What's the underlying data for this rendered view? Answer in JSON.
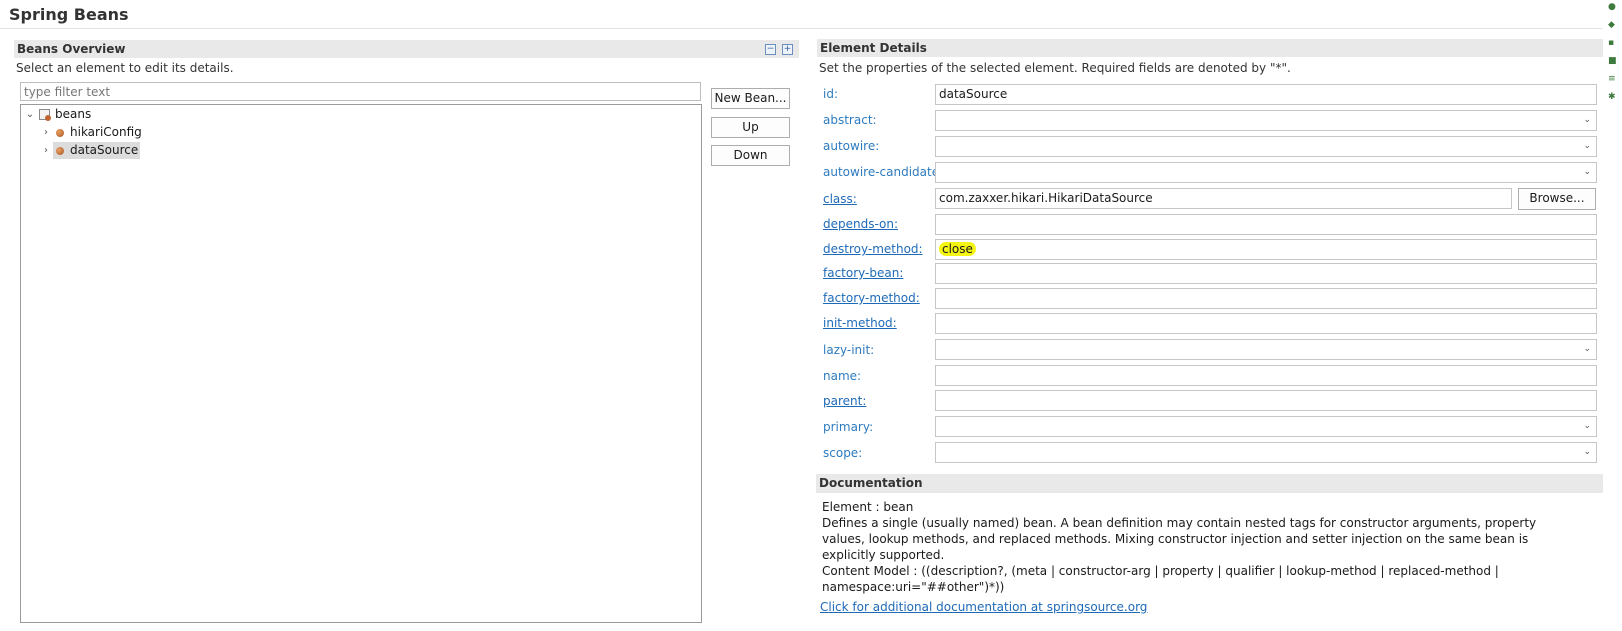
{
  "page_title": "Spring Beans",
  "beans_overview": {
    "title": "Beans Overview",
    "description": "Select an element to edit its details.",
    "filter_placeholder": "type filter text",
    "tree": {
      "root": "beans",
      "children": [
        "hikariConfig",
        "dataSource"
      ],
      "selected": "dataSource"
    },
    "buttons": {
      "new_bean": "New Bean...",
      "up": "Up",
      "down": "Down"
    }
  },
  "element_details": {
    "title": "Element Details",
    "description": "Set the properties of the selected element. Required fields are denoted by \"*\".",
    "fields": {
      "id": {
        "label": "id:",
        "value": "dataSource"
      },
      "abstract": {
        "label": "abstract:",
        "value": ""
      },
      "autowire": {
        "label": "autowire:",
        "value": ""
      },
      "autowire_candidate": {
        "label": "autowire-candidate:",
        "value": ""
      },
      "class": {
        "label": "class:",
        "value": "com.zaxxer.hikari.HikariDataSource"
      },
      "depends_on": {
        "label": "depends-on:",
        "value": ""
      },
      "destroy_method": {
        "label": "destroy-method:",
        "value": "close"
      },
      "factory_bean": {
        "label": "factory-bean:",
        "value": ""
      },
      "factory_method": {
        "label": "factory-method:",
        "value": ""
      },
      "init_method": {
        "label": "init-method:",
        "value": ""
      },
      "lazy_init": {
        "label": "lazy-init:",
        "value": ""
      },
      "name": {
        "label": "name:",
        "value": ""
      },
      "parent": {
        "label": "parent:",
        "value": ""
      },
      "primary": {
        "label": "primary:",
        "value": ""
      },
      "scope": {
        "label": "scope:",
        "value": ""
      }
    },
    "browse_button": "Browse..."
  },
  "documentation": {
    "title": "Documentation",
    "element": "Element : bean",
    "description": "Defines a single (usually named) bean. A bean definition may contain nested tags for constructor arguments, property values, lookup methods, and replaced methods. Mixing constructor injection and setter injection on the same bean is explicitly supported.",
    "content_model": "Content Model : ((description?, (meta | constructor-arg | property | qualifier | lookup-method | replaced-method | namespace:uri=\"##other\")*))",
    "link": "Click for additional documentation at springsource.org"
  },
  "colors": {
    "highlight": "#f5f514",
    "link": "#1e6ab8",
    "label": "#2d7bbf",
    "section_bg": "#e9e9e9"
  },
  "icons": [
    "collapse-all-icon",
    "expand-all-icon",
    "beans-icon",
    "bean-icon",
    "chevron-down-icon",
    "chevron-right-icon"
  ]
}
